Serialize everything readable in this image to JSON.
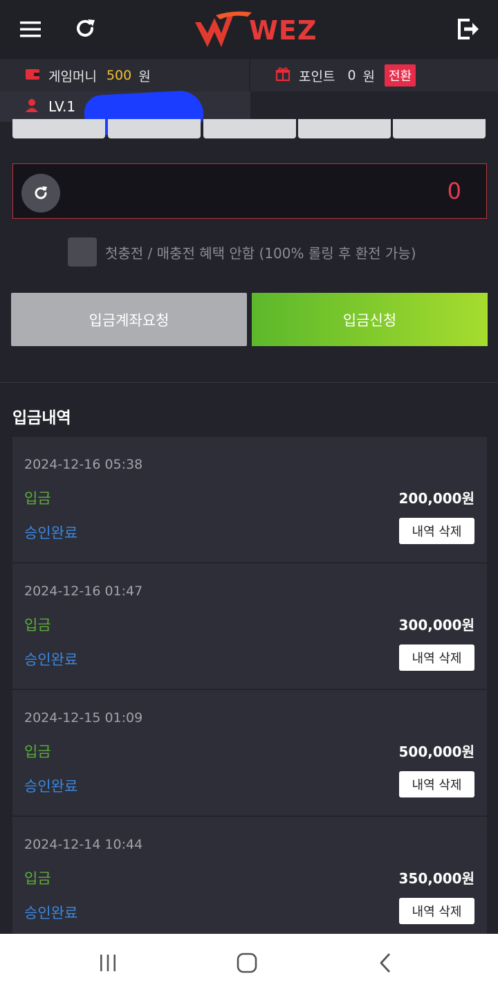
{
  "header": {
    "logo_text": "WEZ",
    "menu_icon": "hamburger-menu-icon",
    "refresh_icon": "refresh-icon",
    "logout_icon": "logout-icon"
  },
  "wallet": {
    "game_money_label": "게임머니",
    "game_money_value": "500",
    "game_money_unit": "원",
    "point_label": "포인트",
    "point_value": "0",
    "point_unit": "원",
    "convert_label": "전환",
    "level_label": "LV.1"
  },
  "deposit": {
    "amount": "0",
    "bonus_option_label": "첫충전 / 매충전 혜택 안함 (100% 롤링 후 환전 가능)",
    "account_request_label": "입금계좌요청",
    "apply_label": "입금신청"
  },
  "history": {
    "title": "입금내역",
    "records": [
      {
        "date": "2024-12-16 05:38",
        "type": "입금",
        "amount": "200,000원",
        "status": "승인완료",
        "delete_label": "내역 삭제"
      },
      {
        "date": "2024-12-16 01:47",
        "type": "입금",
        "amount": "300,000원",
        "status": "승인완료",
        "delete_label": "내역 삭제"
      },
      {
        "date": "2024-12-15 01:09",
        "type": "입금",
        "amount": "500,000원",
        "status": "승인완료",
        "delete_label": "내역 삭제"
      },
      {
        "date": "2024-12-14 10:44",
        "type": "입금",
        "amount": "350,000원",
        "status": "승인완료",
        "delete_label": "내역 삭제"
      }
    ]
  },
  "colors": {
    "background": "#22232b",
    "accent_red": "#e52d4a",
    "gold": "#f2c230",
    "green": "#5fae3a",
    "blue": "#3b88e0"
  }
}
